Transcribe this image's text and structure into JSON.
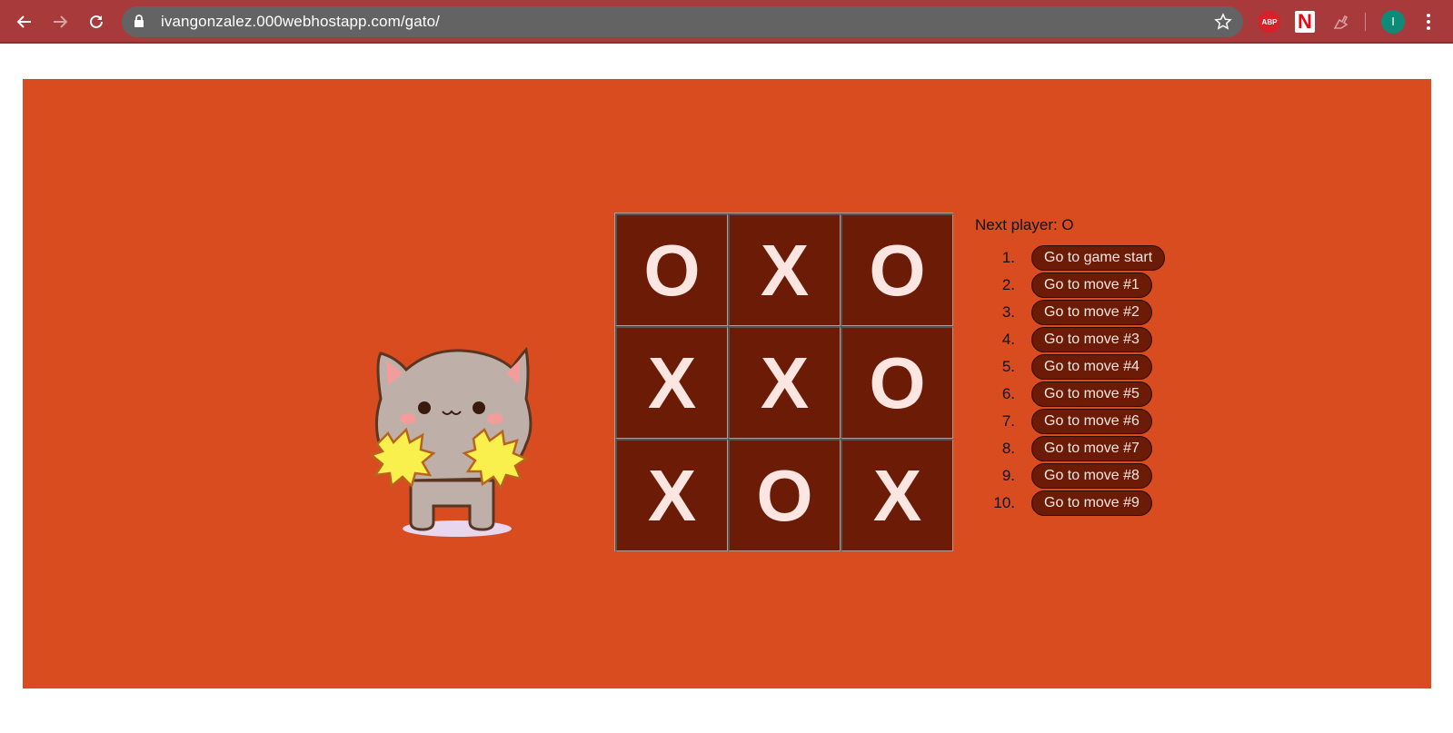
{
  "browser": {
    "url": "ivangonzalez.000webhostapp.com/gato/",
    "extensions": [
      "ABP",
      "N"
    ],
    "profile_initial": "I"
  },
  "game": {
    "status": "Next player: O",
    "board": [
      "O",
      "X",
      "O",
      "X",
      "X",
      "O",
      "X",
      "O",
      "X"
    ],
    "history": [
      {
        "num": "1.",
        "label": "Go to game start"
      },
      {
        "num": "2.",
        "label": "Go to move #1"
      },
      {
        "num": "3.",
        "label": "Go to move #2"
      },
      {
        "num": "4.",
        "label": "Go to move #3"
      },
      {
        "num": "5.",
        "label": "Go to move #4"
      },
      {
        "num": "6.",
        "label": "Go to move #5"
      },
      {
        "num": "7.",
        "label": "Go to move #6"
      },
      {
        "num": "8.",
        "label": "Go to move #7"
      },
      {
        "num": "9.",
        "label": "Go to move #8"
      },
      {
        "num": "10.",
        "label": "Go to move #9"
      }
    ]
  },
  "colors": {
    "chrome": "#a83a3c",
    "page_bg": "#d84c20",
    "square_bg": "#6b1b06",
    "mark": "#fde6e1"
  }
}
